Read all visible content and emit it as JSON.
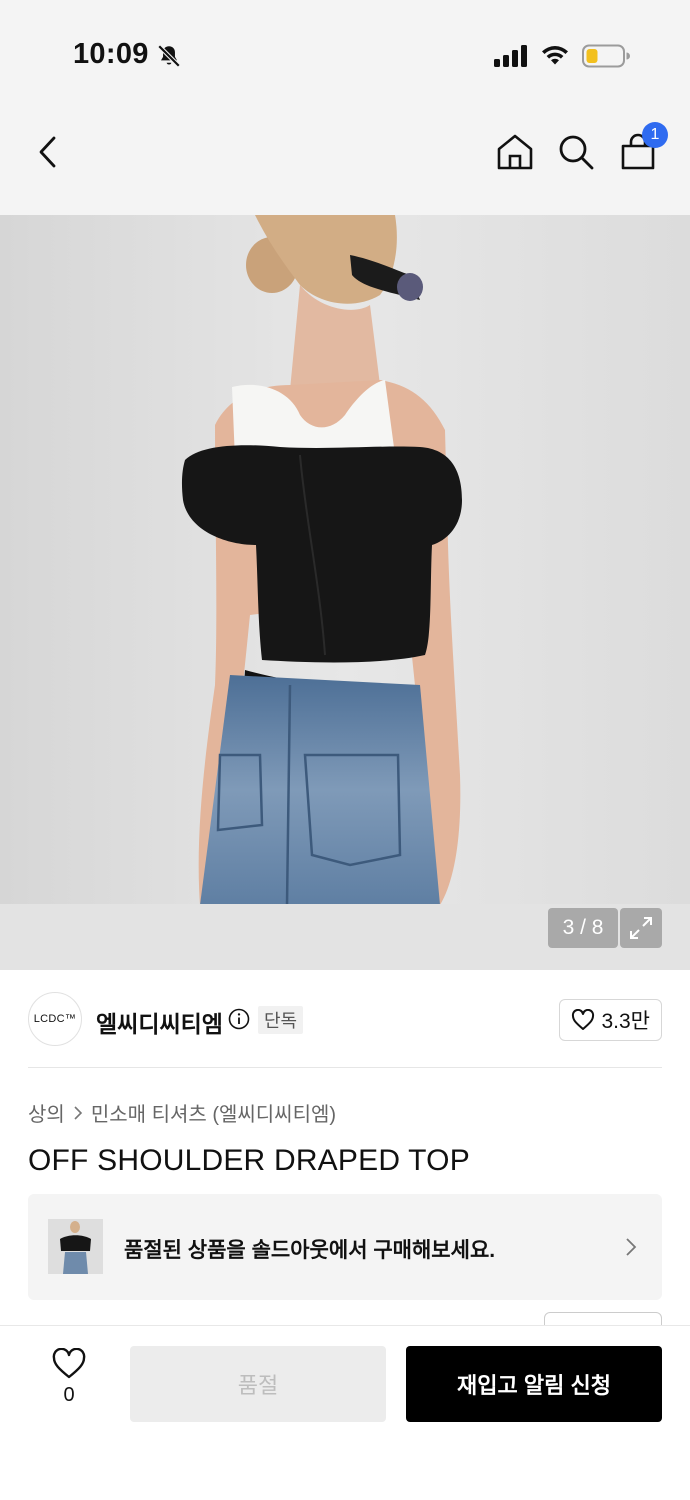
{
  "status_bar": {
    "time": "10:09",
    "icons": [
      "bell-slash-icon",
      "cellular-signal-icon",
      "wifi-icon",
      "battery-low-icon"
    ],
    "battery_color": "#f2c01e"
  },
  "nav": {
    "back_icon": "chevron-left-icon",
    "home_icon": "home-icon",
    "search_icon": "search-icon",
    "cart_icon": "shopping-bag-icon",
    "cart_badge": "1",
    "badge_color": "#2f6bf0"
  },
  "gallery": {
    "counter": "3 / 8",
    "expand_icon": "expand-icon",
    "image_alt": "model wearing black off-shoulder top with white tank and denim jeans"
  },
  "brand": {
    "logo_text": "LCDC™",
    "name": "엘씨디씨티엠",
    "badge": "단독",
    "like_count": "3.3만"
  },
  "product": {
    "breadcrumb": [
      "상의",
      "민소매 티셔츠 (엘씨디씨티엠)"
    ],
    "title": "OFF SHOULDER DRAPED TOP",
    "soldout_banner_text": "품절된 상품을 솔드아웃에서 구매해보세요."
  },
  "bottom_bar": {
    "wish_count": "0",
    "soldout_label": "품절",
    "restock_label": "재입고 알림 신청"
  }
}
